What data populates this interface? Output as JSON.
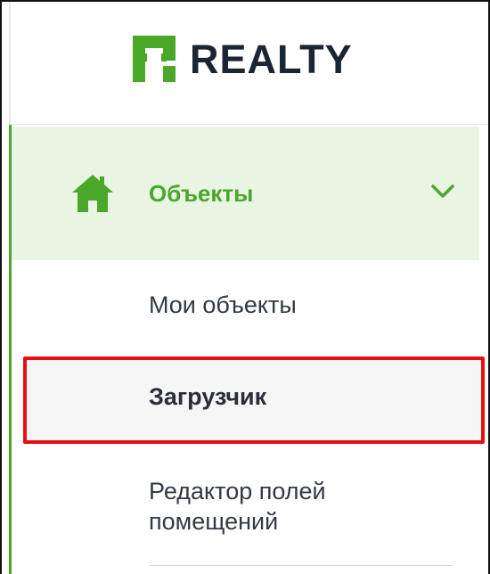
{
  "brand": {
    "name": "REALTY",
    "logo_color": "#4aa829",
    "text_color": "#1c2533"
  },
  "nav": {
    "parent": {
      "label": "Объекты",
      "icon": "home-icon",
      "expanded": true,
      "chevron": "chevron-down-icon"
    },
    "children": [
      {
        "label": "Мои объекты",
        "selected": false
      },
      {
        "label": "Загрузчик",
        "selected": true
      },
      {
        "label": "Редактор полей помещений",
        "selected": false
      }
    ]
  },
  "colors": {
    "accent": "#49a82a",
    "active_bg": "#eaf4e2",
    "highlight_border": "#e60e0e"
  }
}
